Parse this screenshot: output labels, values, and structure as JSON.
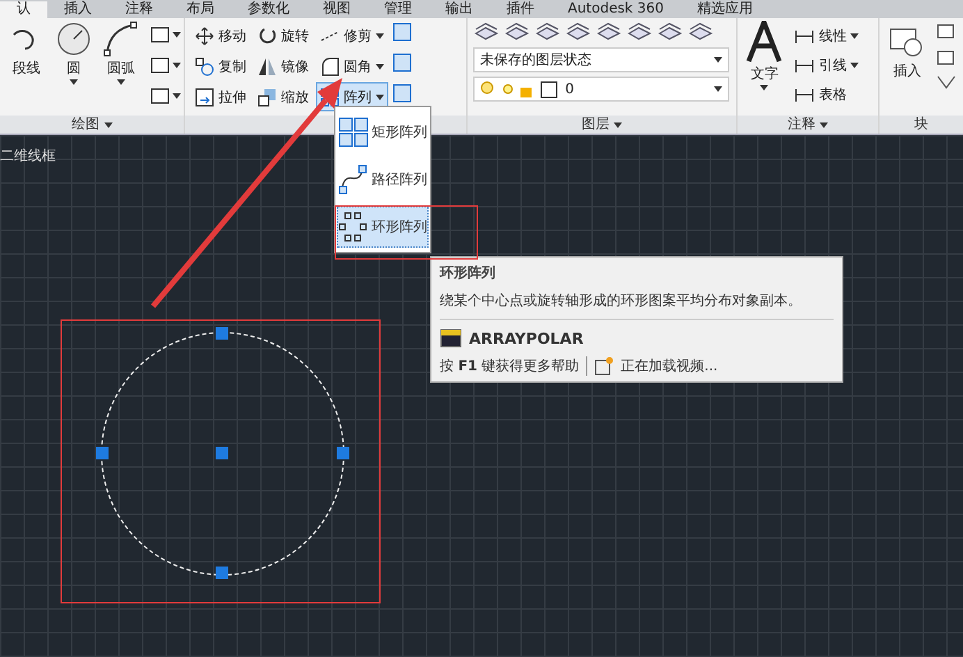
{
  "tabs": [
    {
      "label": "认",
      "selected": true
    },
    {
      "label": "插入",
      "selected": false
    },
    {
      "label": "注释",
      "selected": false
    },
    {
      "label": "布局",
      "selected": false
    },
    {
      "label": "参数化",
      "selected": false
    },
    {
      "label": "视图",
      "selected": false
    },
    {
      "label": "管理",
      "selected": false
    },
    {
      "label": "输出",
      "selected": false
    },
    {
      "label": "插件",
      "selected": false
    },
    {
      "label": "Autodesk 360",
      "selected": false
    },
    {
      "label": "精选应用",
      "selected": false
    }
  ],
  "draw_panel": {
    "title": "绘图",
    "big_buttons": [
      "段线",
      "圆",
      "圆弧"
    ]
  },
  "modify_panel": {
    "rows": [
      [
        {
          "label": "移动",
          "dropdown": false,
          "selected": false
        },
        {
          "label": "旋转",
          "dropdown": false,
          "selected": false
        },
        {
          "label": "修剪",
          "dropdown": true,
          "selected": false
        }
      ],
      [
        {
          "label": "复制",
          "dropdown": false,
          "selected": false
        },
        {
          "label": "镜像",
          "dropdown": false,
          "selected": false
        },
        {
          "label": "圆角",
          "dropdown": true,
          "selected": false
        }
      ],
      [
        {
          "label": "拉伸",
          "dropdown": false,
          "selected": false
        },
        {
          "label": "缩放",
          "dropdown": false,
          "selected": false
        },
        {
          "label": "阵列",
          "dropdown": true,
          "selected": true
        }
      ]
    ]
  },
  "layer_panel": {
    "title": "图层",
    "state_dropdown": "未保存的图层状态",
    "layer_dropdown": "0"
  },
  "annotate_panel": {
    "title": "注释",
    "big_button": "文字",
    "items": [
      {
        "label": "线性",
        "dropdown": true
      },
      {
        "label": "引线",
        "dropdown": true
      },
      {
        "label": "表格",
        "dropdown": false
      }
    ]
  },
  "block_panel": {
    "title": "块",
    "big_button": "插入"
  },
  "array_menu": [
    {
      "label": "矩形阵列",
      "selected": false
    },
    {
      "label": "路径阵列",
      "selected": false
    },
    {
      "label": "环形阵列",
      "selected": true
    }
  ],
  "tooltip": {
    "title": "环形阵列",
    "description": "绕某个中心点或旋转轴形成的环形图案平均分布对象副本。",
    "command": "ARRAYPOLAR",
    "help_text": "按 **F1** 键获得更多帮助",
    "video_text": "正在加载视频..."
  },
  "viewport": {
    "label": "二维线框"
  }
}
